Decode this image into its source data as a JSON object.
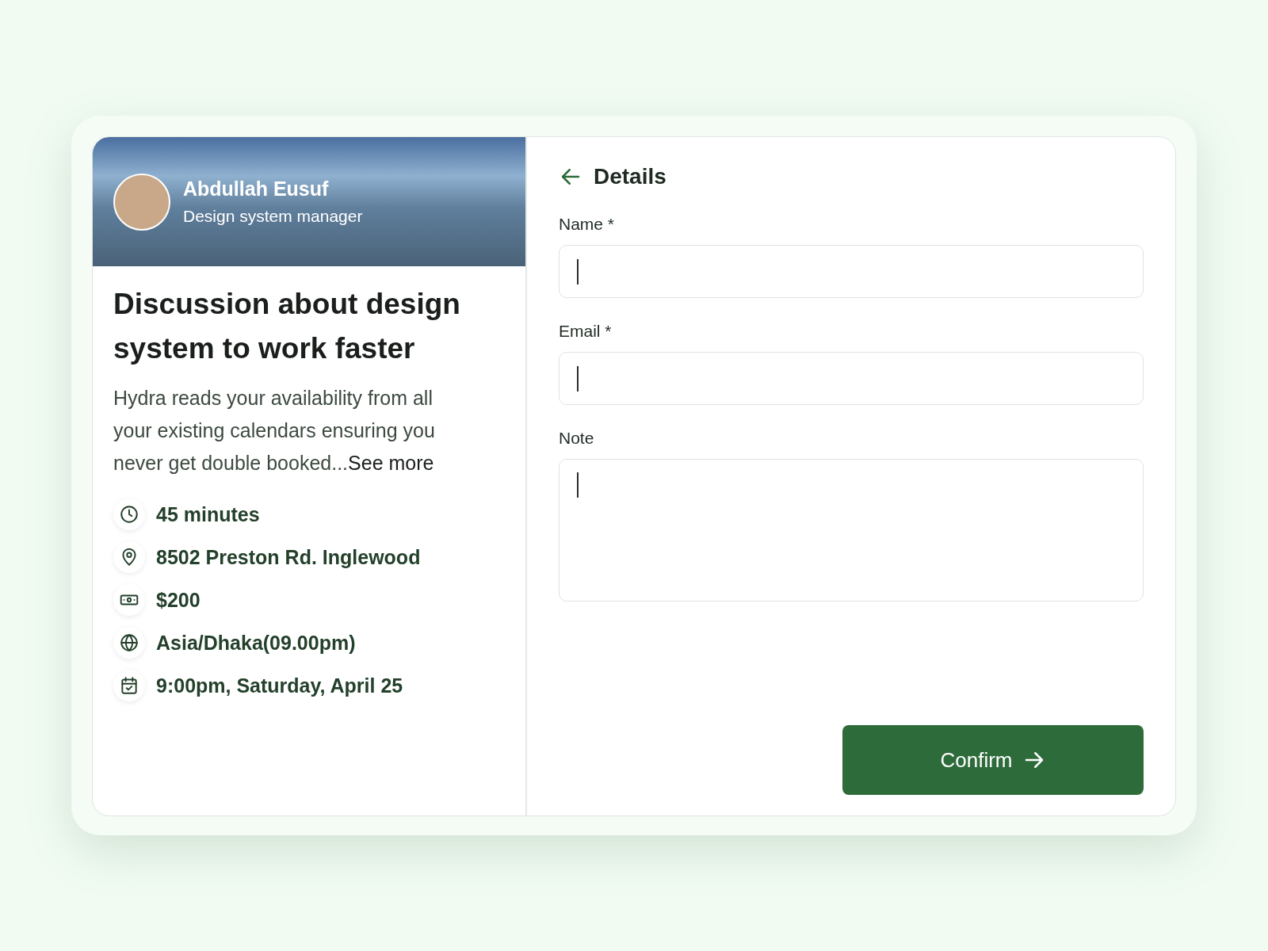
{
  "host": {
    "name": "Abdullah Eusuf",
    "role": "Design system manager"
  },
  "event": {
    "title": "Discussion about design system to work faster",
    "description": "Hydra reads your availability from all your existing calendars ensuring you never get double booked...",
    "link": "See more"
  },
  "details": [
    {
      "kind": "duration",
      "text": "45 minutes"
    },
    {
      "kind": "location",
      "text": "8502 Preston Rd. Inglewood"
    },
    {
      "kind": "price",
      "text": "$200"
    },
    {
      "kind": "timezone",
      "text": "Asia/Dhaka(09.00pm)"
    },
    {
      "kind": "date",
      "text": "9:00pm, Saturday, April 25"
    }
  ],
  "form": {
    "title": "Details",
    "fields": [
      {
        "label": "Name *",
        "kind": "text"
      },
      {
        "label": "Email *",
        "kind": "text"
      },
      {
        "label": "Note",
        "kind": "textarea"
      }
    ]
  },
  "confirm_button": {
    "label": "Confirm"
  }
}
